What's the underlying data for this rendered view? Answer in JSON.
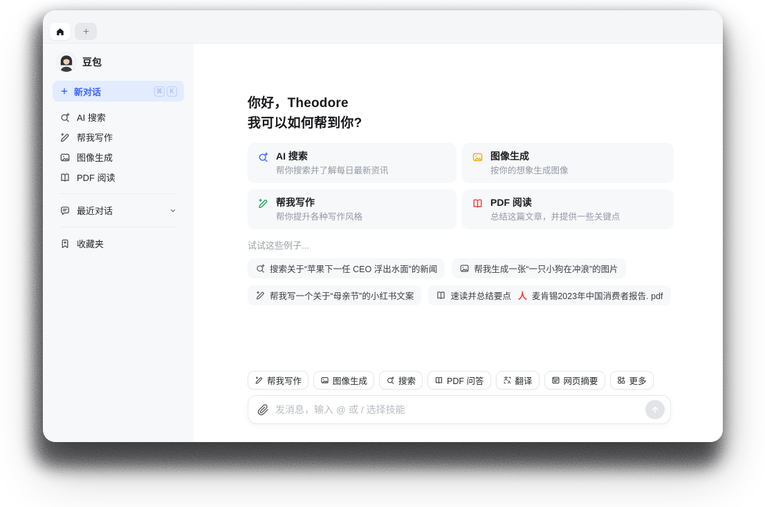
{
  "colors": {
    "accent_blue": "#3a66f7",
    "new_chat_bg": "#e3ebff",
    "card_bg": "#f7f8fa",
    "sidebar_bg": "#f7f8fa",
    "icon_search_blue": "#3a6bff",
    "icon_image_yellow": "#f0b114",
    "icon_write_green": "#22ac5e",
    "icon_pdf_red": "#f0443a",
    "pdf_attachment_red": "#f23c30"
  },
  "tabbar": {
    "home_tab_icon": "home-icon",
    "add_tab_icon": "plus-icon"
  },
  "sidebar": {
    "profile": {
      "name": "豆包",
      "avatar": "doubao-girl-avatar"
    },
    "new_chat": {
      "label": "新对话",
      "keys": [
        "⌘",
        "K"
      ]
    },
    "nav_items": [
      {
        "icon": "ai-search-icon",
        "label": "AI 搜索"
      },
      {
        "icon": "write-icon",
        "label": "帮我写作"
      },
      {
        "icon": "image-gen-icon",
        "label": "图像生成"
      },
      {
        "icon": "pdf-read-icon",
        "label": "PDF 阅读"
      }
    ],
    "recent": {
      "icon": "chat-bubble-icon",
      "label": "最近对话",
      "chevron": "chevron-down-icon"
    },
    "favorites": {
      "icon": "bookmark-icon",
      "label": "收藏夹"
    }
  },
  "main": {
    "greeting_line1": "你好，Theodore",
    "greeting_line2": "我可以如何帮到你?",
    "cards": [
      {
        "icon": "ai-search-icon",
        "color": "#3a6bff",
        "title": "AI 搜索",
        "desc": "帮你搜索并了解每日最新资讯"
      },
      {
        "icon": "image-gen-icon",
        "color": "#f0b114",
        "title": "图像生成",
        "desc": "按你的想象生成图像"
      },
      {
        "icon": "write-icon",
        "color": "#22ac5e",
        "title": "帮我写作",
        "desc": "帮你提升各种写作风格"
      },
      {
        "icon": "pdf-read-icon",
        "color": "#f0443a",
        "title": "PDF 阅读",
        "desc": "总结这篇文章，并提供一些关键点"
      }
    ],
    "examples_hint": "试试这些例子...",
    "examples": [
      {
        "icon": "ai-search-icon",
        "text": "搜索关于“苹果下一任 CEO 浮出水面”的新闻"
      },
      {
        "icon": "image-gen-icon",
        "text": "帮我生成一张“一只小狗在冲浪”的图片"
      },
      {
        "icon": "write-icon",
        "text": "帮我写一个关于“母亲节”的小红书文案"
      },
      {
        "icon": "pdf-read-icon",
        "prefix": "速读并总结要点",
        "attachment_icon": "adobe-pdf-icon",
        "attachment": "麦肯锡2023年中国消费者报告. pdf"
      }
    ]
  },
  "composer": {
    "skills": [
      {
        "icon": "write-icon",
        "label": "帮我写作"
      },
      {
        "icon": "image-gen-icon",
        "label": "图像生成"
      },
      {
        "icon": "ai-search-icon",
        "label": "搜索"
      },
      {
        "icon": "pdf-read-icon",
        "label": "PDF 问答"
      },
      {
        "icon": "translate-icon",
        "label": "翻译"
      },
      {
        "icon": "webpage-icon",
        "label": "网页摘要"
      },
      {
        "icon": "more-icon",
        "label": "更多"
      }
    ],
    "input": {
      "placeholder": "发消息，输入 @ 或 / 选择技能",
      "value": ""
    },
    "attach_icon": "paperclip-icon",
    "send_icon": "arrow-up-icon"
  }
}
